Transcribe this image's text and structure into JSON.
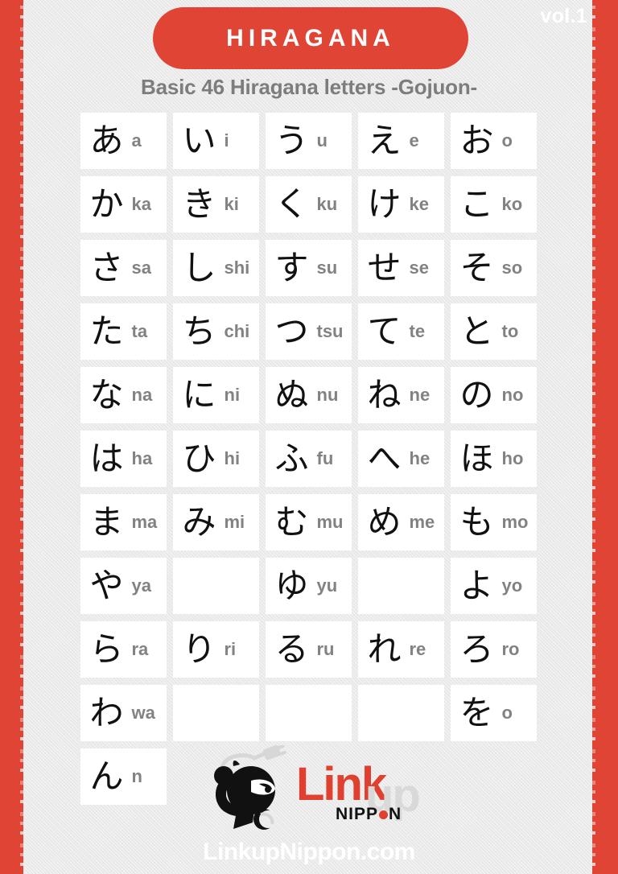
{
  "header": {
    "volume": "vol.1",
    "title": "HIRAGANA",
    "subtitle": "Basic 46 Hiragana letters -Gojuon-"
  },
  "colors": {
    "accent_red": "#df4435",
    "logo_red": "#e0402f",
    "background": "#e9e9e9",
    "cell_background": "#ffffff",
    "romaji_gray": "#828282",
    "subtitle_gray": "#7d7d7d"
  },
  "grid": {
    "columns": 5,
    "rows": [
      {
        "name": "a-row",
        "cells": [
          {
            "kana": "あ",
            "romaji": "a"
          },
          {
            "kana": "い",
            "romaji": "i"
          },
          {
            "kana": "う",
            "romaji": "u"
          },
          {
            "kana": "え",
            "romaji": "e"
          },
          {
            "kana": "お",
            "romaji": "o"
          }
        ]
      },
      {
        "name": "ka-row",
        "cells": [
          {
            "kana": "か",
            "romaji": "ka"
          },
          {
            "kana": "き",
            "romaji": "ki"
          },
          {
            "kana": "く",
            "romaji": "ku"
          },
          {
            "kana": "け",
            "romaji": "ke"
          },
          {
            "kana": "こ",
            "romaji": "ko"
          }
        ]
      },
      {
        "name": "sa-row",
        "cells": [
          {
            "kana": "さ",
            "romaji": "sa"
          },
          {
            "kana": "し",
            "romaji": "shi"
          },
          {
            "kana": "す",
            "romaji": "su"
          },
          {
            "kana": "せ",
            "romaji": "se"
          },
          {
            "kana": "そ",
            "romaji": "so"
          }
        ]
      },
      {
        "name": "ta-row",
        "cells": [
          {
            "kana": "た",
            "romaji": "ta"
          },
          {
            "kana": "ち",
            "romaji": "chi"
          },
          {
            "kana": "つ",
            "romaji": "tsu"
          },
          {
            "kana": "て",
            "romaji": "te"
          },
          {
            "kana": "と",
            "romaji": "to"
          }
        ]
      },
      {
        "name": "na-row",
        "cells": [
          {
            "kana": "な",
            "romaji": "na"
          },
          {
            "kana": "に",
            "romaji": "ni"
          },
          {
            "kana": "ぬ",
            "romaji": "nu"
          },
          {
            "kana": "ね",
            "romaji": "ne"
          },
          {
            "kana": "の",
            "romaji": "no"
          }
        ]
      },
      {
        "name": "ha-row",
        "cells": [
          {
            "kana": "は",
            "romaji": "ha"
          },
          {
            "kana": "ひ",
            "romaji": "hi"
          },
          {
            "kana": "ふ",
            "romaji": "fu"
          },
          {
            "kana": "へ",
            "romaji": "he"
          },
          {
            "kana": "ほ",
            "romaji": "ho"
          }
        ]
      },
      {
        "name": "ma-row",
        "cells": [
          {
            "kana": "ま",
            "romaji": "ma"
          },
          {
            "kana": "み",
            "romaji": "mi"
          },
          {
            "kana": "む",
            "romaji": "mu"
          },
          {
            "kana": "め",
            "romaji": "me"
          },
          {
            "kana": "も",
            "romaji": "mo"
          }
        ]
      },
      {
        "name": "ya-row",
        "cells": [
          {
            "kana": "や",
            "romaji": "ya"
          },
          {
            "kana": "",
            "romaji": ""
          },
          {
            "kana": "ゆ",
            "romaji": "yu"
          },
          {
            "kana": "",
            "romaji": ""
          },
          {
            "kana": "よ",
            "romaji": "yo"
          }
        ]
      },
      {
        "name": "ra-row",
        "cells": [
          {
            "kana": "ら",
            "romaji": "ra"
          },
          {
            "kana": "り",
            "romaji": "ri"
          },
          {
            "kana": "る",
            "romaji": "ru"
          },
          {
            "kana": "れ",
            "romaji": "re"
          },
          {
            "kana": "ろ",
            "romaji": "ro"
          }
        ]
      },
      {
        "name": "wa-row",
        "cells": [
          {
            "kana": "わ",
            "romaji": "wa"
          },
          {
            "kana": "",
            "romaji": ""
          },
          {
            "kana": "",
            "romaji": ""
          },
          {
            "kana": "",
            "romaji": ""
          },
          {
            "kana": "を",
            "romaji": "o"
          }
        ]
      },
      {
        "name": "n-row",
        "cells": [
          {
            "kana": "ん",
            "romaji": "n"
          },
          {
            "kana": null,
            "romaji": null
          },
          {
            "kana": null,
            "romaji": null
          },
          {
            "kana": null,
            "romaji": null
          },
          {
            "kana": null,
            "romaji": null
          }
        ]
      }
    ]
  },
  "footer": {
    "logo": {
      "mascot": "ninja-mascot-icon",
      "link_text": "Link",
      "up_text": "up",
      "nippon_prefix": "NIPP",
      "nippon_suffix": "N"
    },
    "website": "LinkupNippon.com"
  }
}
